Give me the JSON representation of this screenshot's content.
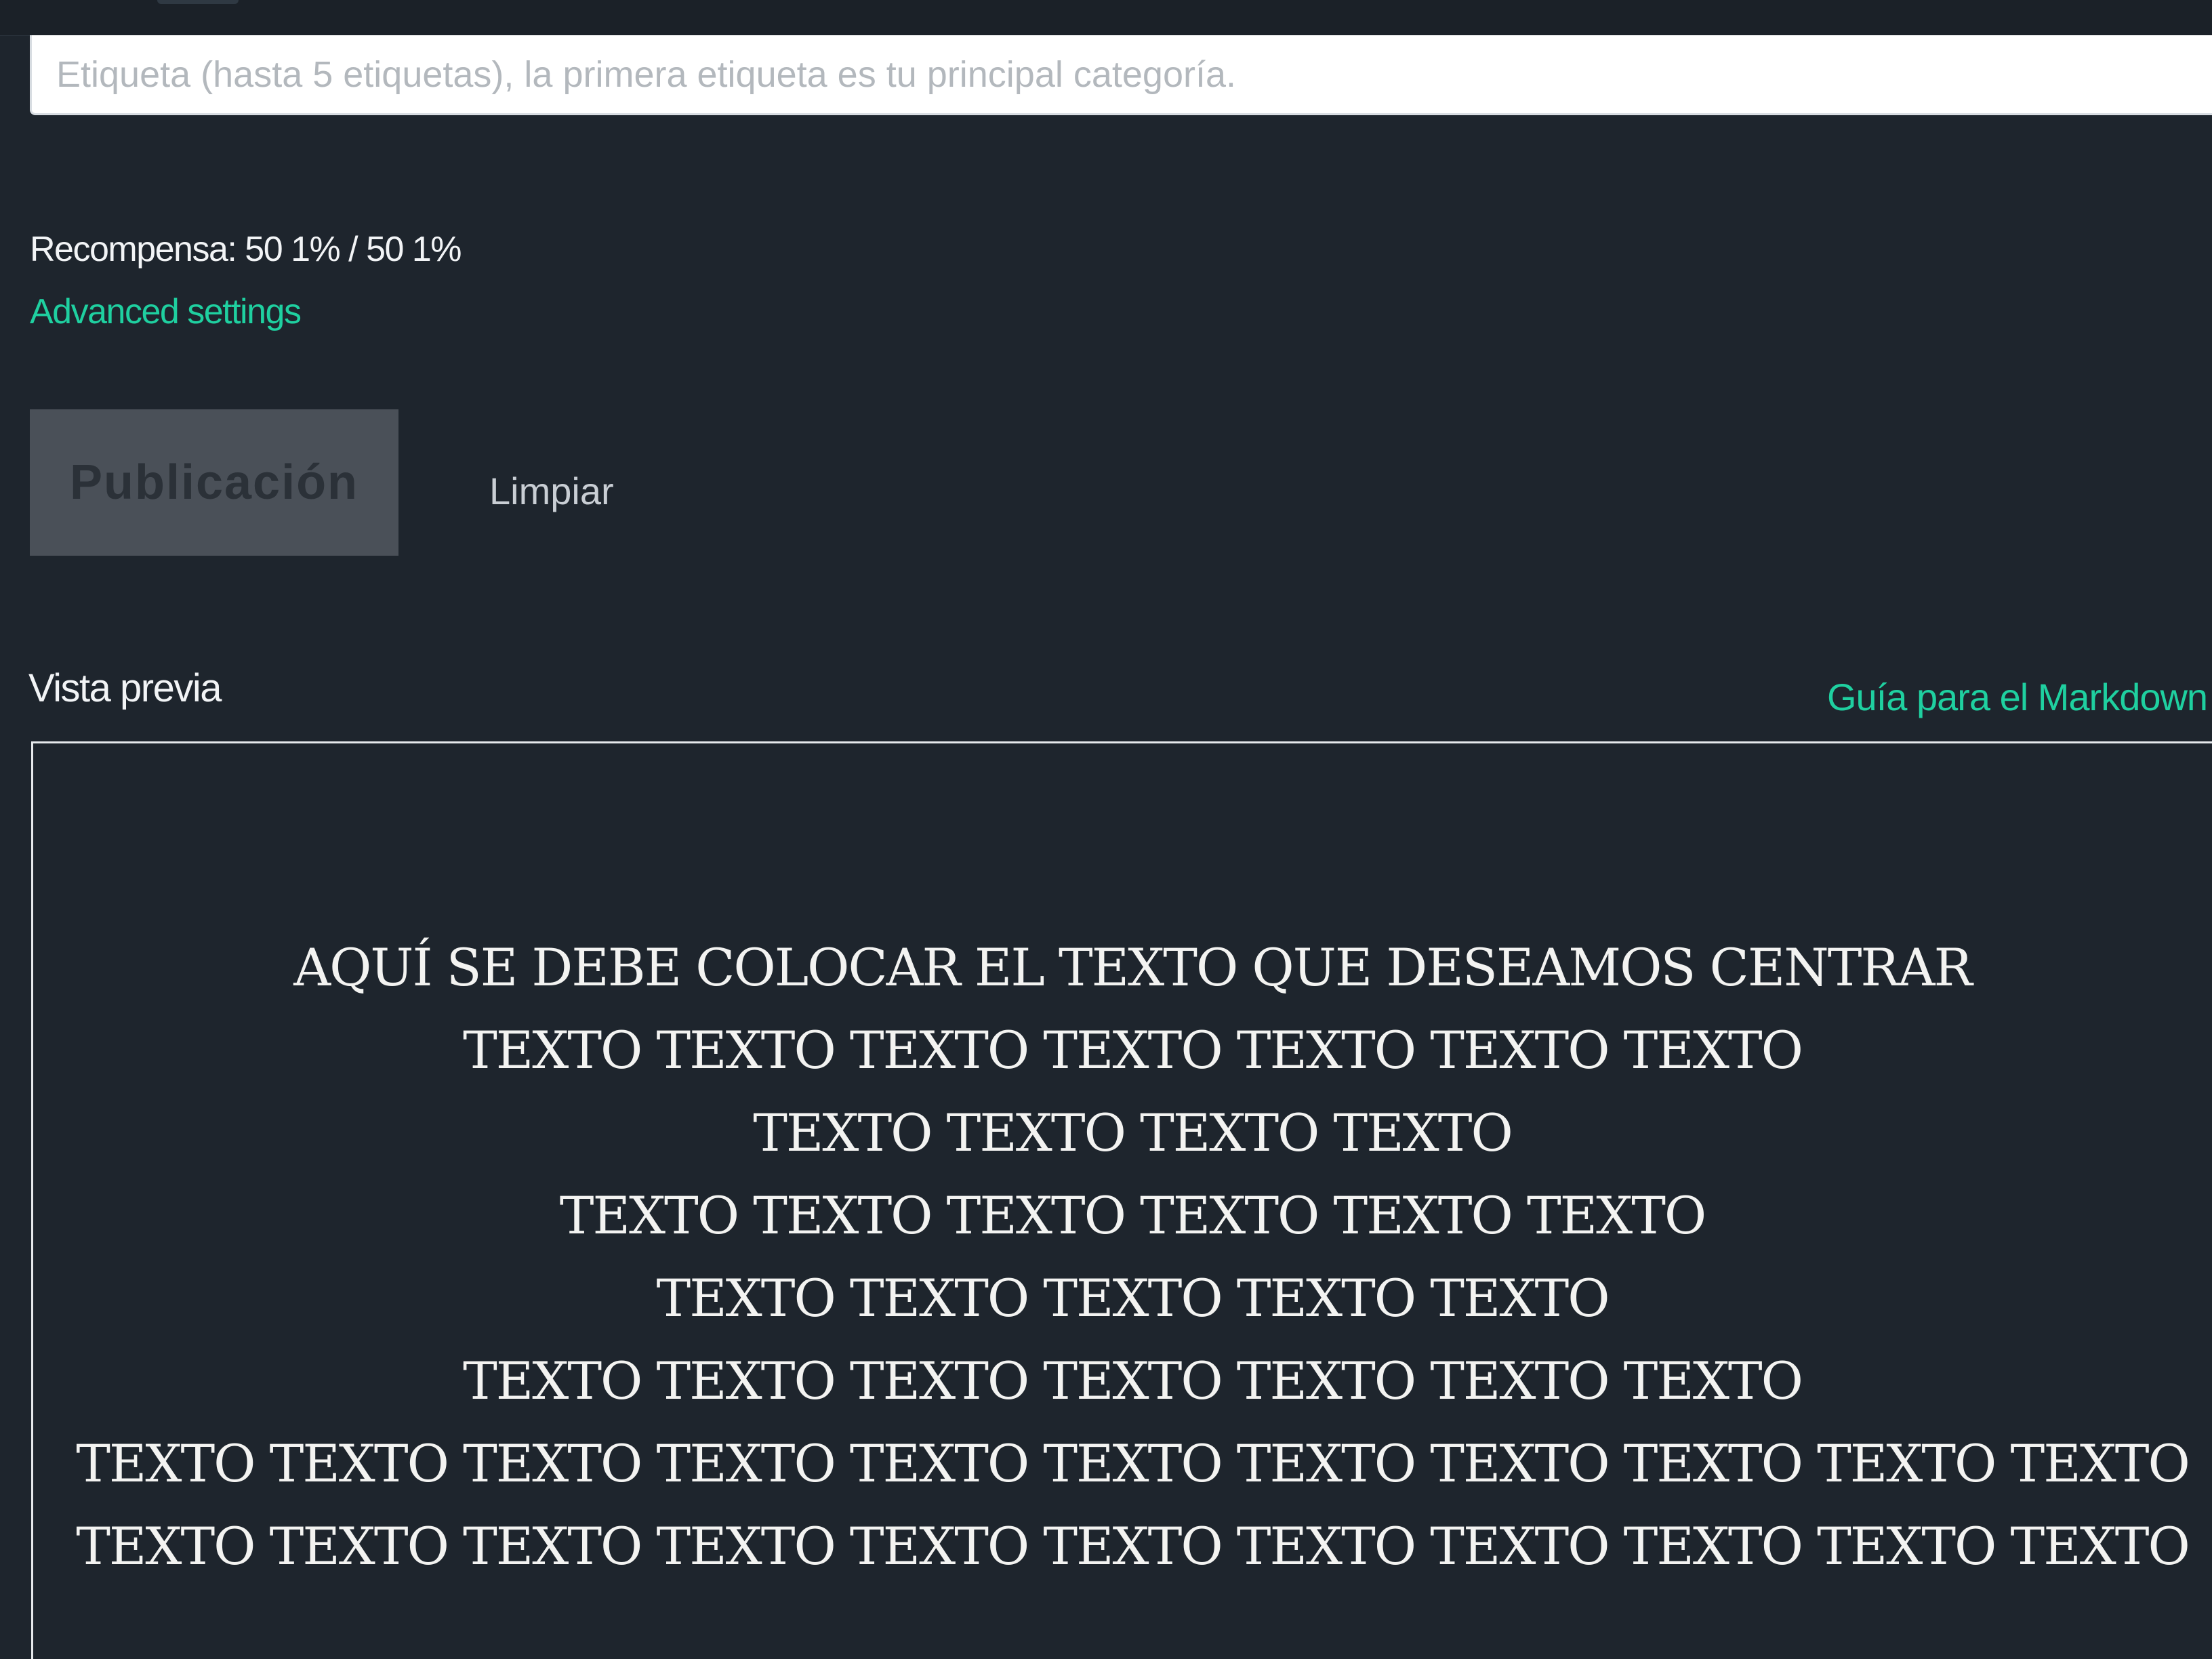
{
  "form": {
    "tags_placeholder": "Etiqueta (hasta 5 etiquetas), la primera etiqueta es tu principal categoría.",
    "reward_text": "Recompensa: 50 1% / 50 1%",
    "advanced_settings_label": "Advanced settings",
    "publish_label": "Publicación",
    "clear_label": "Limpiar"
  },
  "preview": {
    "title": "Vista previa",
    "markdown_guide_label": "Guía para el Markdown",
    "lines": [
      "AQUÍ SE DEBE COLOCAR EL TEXTO QUE DESEAMOS CENTRAR",
      "TEXTO TEXTO TEXTO TEXTO TEXTO TEXTO TEXTO",
      "TEXTO TEXTO TEXTO TEXTO",
      "TEXTO TEXTO TEXTO TEXTO TEXTO TEXTO",
      "TEXTO TEXTO TEXTO TEXTO TEXTO",
      "TEXTO TEXTO TEXTO TEXTO TEXTO TEXTO TEXTO",
      "TEXTO TEXTO TEXTO TEXTO TEXTO TEXTO TEXTO TEXTO TEXTO TEXTO TEXTO",
      "TEXTO TEXTO TEXTO TEXTO TEXTO TEXTO TEXTO TEXTO TEXTO TEXTO TEXTO"
    ]
  },
  "colors": {
    "background": "#1e252d",
    "accent_link": "#1fd0a0",
    "disabled_button": "#4a5058",
    "preview_border": "#e6e9ec"
  }
}
